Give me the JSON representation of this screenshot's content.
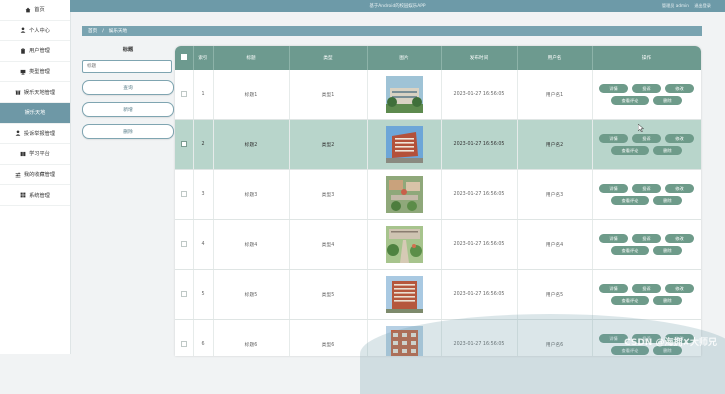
{
  "app": {
    "title": "基于Android的校园娱乐APP",
    "admin_label": "管理员 admin",
    "logout_label": "退出登录"
  },
  "sidebar": {
    "items": [
      {
        "label": "首页",
        "icon": "home-icon"
      },
      {
        "label": "个人中心",
        "icon": "user-icon"
      },
      {
        "label": "用户管理",
        "icon": "clipboard-icon"
      },
      {
        "label": "类型管理",
        "icon": "monitor-icon"
      },
      {
        "label": "娱乐天地管理",
        "icon": "gift-icon"
      },
      {
        "label": "娱乐天地",
        "icon": "",
        "active": true
      },
      {
        "label": "投诉举报管理",
        "icon": "user-icon"
      },
      {
        "label": "学习平台",
        "icon": "book-icon"
      },
      {
        "label": "我的收藏管理",
        "icon": "sliders-icon"
      },
      {
        "label": "系统管理",
        "icon": "grid-icon"
      }
    ]
  },
  "breadcrumb": {
    "home": "首页",
    "sep": "/",
    "current": "娱乐天地"
  },
  "search": {
    "label": "标题",
    "placeholder": "标题",
    "query_label": "查询",
    "add_label": "新增",
    "delete_label": "删除"
  },
  "table": {
    "headers": [
      "索引",
      "标题",
      "类型",
      "图片",
      "发布时间",
      "用户名",
      "操作"
    ],
    "rows": [
      {
        "index": "1",
        "title": "标题1",
        "type": "类型1",
        "time": "2023-01-27 16:56:05",
        "user": "用户名1",
        "image": "building-green"
      },
      {
        "index": "2",
        "title": "标题2",
        "type": "类型2",
        "time": "2023-01-27 16:56:05",
        "user": "用户名2",
        "image": "building-red",
        "selected": true
      },
      {
        "index": "3",
        "title": "标题3",
        "type": "类型3",
        "time": "2023-01-27 16:56:05",
        "user": "用户名3",
        "image": "campus-aerial"
      },
      {
        "index": "4",
        "title": "标题4",
        "type": "类型4",
        "time": "2023-01-27 16:56:05",
        "user": "用户名4",
        "image": "garden-path"
      },
      {
        "index": "5",
        "title": "标题5",
        "type": "类型5",
        "time": "2023-01-27 16:56:05",
        "user": "用户名5",
        "image": "building-brick"
      },
      {
        "index": "6",
        "title": "标题6",
        "type": "类型6",
        "time": "2023-01-27 16:56:05",
        "user": "用户名6",
        "image": "building-brick-2"
      }
    ],
    "actions": {
      "detail": "详情",
      "report": "投诉",
      "edit": "修改",
      "comments": "查看评论",
      "delete": "删除"
    }
  },
  "watermark": "CSDN @海拥✘大师兄",
  "colors": {
    "accent": "#6d9aa8",
    "header_green": "#6d9a8f",
    "selected_row": "#b8d5cb",
    "button": "#6e9b8a"
  }
}
